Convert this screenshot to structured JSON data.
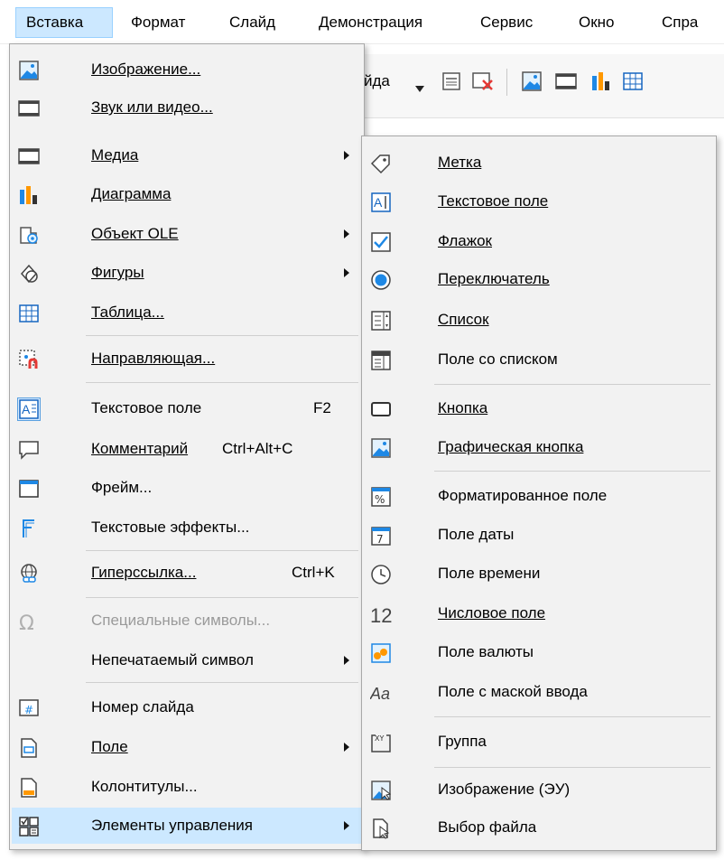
{
  "menubar": {
    "items": [
      "Вставка",
      "Формат",
      "Слайд",
      "Демонстрация",
      "Сервис",
      "Окно",
      "Спра"
    ]
  },
  "toolbar": {
    "partial_text": "йда"
  },
  "insert_menu": {
    "items": [
      {
        "label": "Изображение...",
        "icon": "image-icon"
      },
      {
        "label": "Звук или видео...",
        "icon": "film-icon"
      },
      {
        "label": "Медиа",
        "icon": "film-icon",
        "submenu": true
      },
      {
        "label": "Диаграмма",
        "icon": "chart-icon"
      },
      {
        "label": "Объект OLE",
        "icon": "ole-object-icon",
        "submenu": true
      },
      {
        "label": "Фигуры",
        "icon": "shapes-icon",
        "submenu": true
      },
      {
        "label": "Таблица...",
        "icon": "table-icon"
      },
      {
        "label": "Направляющая...",
        "icon": "snap-guide-icon"
      },
      {
        "label": "Текстовое поле",
        "shortcut": "F2",
        "icon": "text-box-icon"
      },
      {
        "label": "Комментарий",
        "shortcut": "Ctrl+Alt+C",
        "icon": "comment-icon"
      },
      {
        "label": "Фрейм...",
        "icon": "frame-icon"
      },
      {
        "label": "Текстовые эффекты...",
        "icon": "fontwork-icon"
      },
      {
        "label": "Гиперссылка...",
        "shortcut": "Ctrl+K",
        "icon": "hyperlink-icon"
      },
      {
        "label": "Специальные символы...",
        "icon": "omega-icon",
        "disabled": true
      },
      {
        "label": "Непечатаемый символ",
        "icon": "",
        "submenu": true
      },
      {
        "label": "Номер слайда",
        "icon": "slide-number-icon"
      },
      {
        "label": "Поле",
        "icon": "field-icon",
        "submenu": true
      },
      {
        "label": "Колонтитулы...",
        "icon": "header-footer-icon"
      },
      {
        "label": "Элементы управления",
        "icon": "form-controls-icon",
        "submenu": true,
        "highlighted": true
      }
    ]
  },
  "controls_submenu": {
    "items": [
      {
        "label": "Метка",
        "icon": "label-tag-icon"
      },
      {
        "label": "Текстовое поле",
        "icon": "text-field-icon"
      },
      {
        "label": "Флажок",
        "icon": "checkbox-icon"
      },
      {
        "label": "Переключатель",
        "icon": "radio-button-icon"
      },
      {
        "label": "Список",
        "icon": "list-box-icon"
      },
      {
        "label": "Поле со списком",
        "icon": "combo-box-icon"
      },
      {
        "label": "Кнопка",
        "icon": "push-button-icon"
      },
      {
        "label": "Графическая кнопка",
        "icon": "image-button-icon"
      },
      {
        "label": "Форматированное поле",
        "icon": "formatted-field-icon"
      },
      {
        "label": "Поле даты",
        "icon": "date-field-icon"
      },
      {
        "label": "Поле времени",
        "icon": "clock-icon"
      },
      {
        "label": "Числовое поле",
        "icon": "numeric-field-icon",
        "icon_text": "12"
      },
      {
        "label": "Поле валюты",
        "icon": "currency-field-icon"
      },
      {
        "label": "Поле с маской ввода",
        "icon": "pattern-field-icon",
        "icon_text": "Aa"
      },
      {
        "label": "Группа",
        "icon": "group-box-icon",
        "icon_text": "XY"
      },
      {
        "label": "Изображение (ЭУ)",
        "icon": "image-control-icon"
      },
      {
        "label": "Выбор файла",
        "icon": "file-selection-icon"
      }
    ]
  },
  "colors": {
    "highlight": "#cce8ff",
    "menu_bg": "#f2f2f2",
    "accent": "#1e88e5",
    "red": "#e53935"
  }
}
